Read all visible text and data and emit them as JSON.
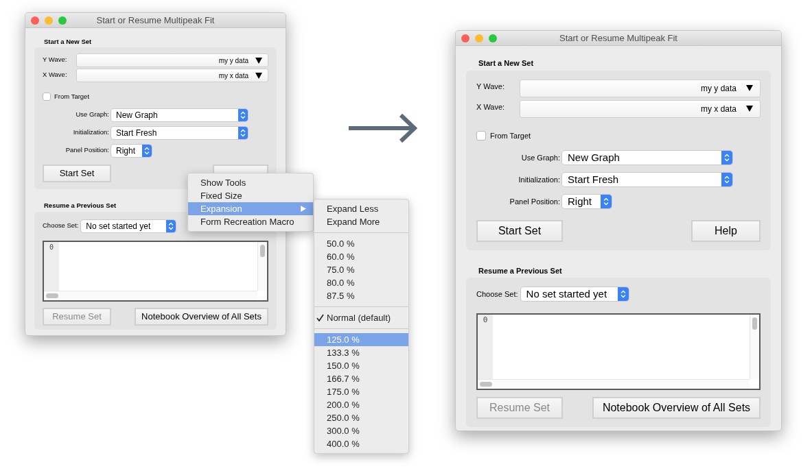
{
  "windows": [
    {
      "title": "Start or Resume Multipeak Fit",
      "new_set": {
        "heading": "Start a New Set",
        "waves": [
          {
            "label": "Y Wave:",
            "value": "my y data"
          },
          {
            "label": "X Wave:",
            "value": "my x data"
          }
        ],
        "from_target": {
          "label": "From Target",
          "checked": false
        },
        "popups": [
          {
            "label": "Use Graph:",
            "value": "New Graph",
            "kind": "wide"
          },
          {
            "label": "Initialization:",
            "value": "Start Fresh",
            "kind": "wide"
          },
          {
            "label": "Panel Position:",
            "value": "Right",
            "kind": "narrow"
          }
        ],
        "buttons": [
          {
            "label": "Start Set",
            "disabled": false
          }
        ]
      },
      "resume": {
        "heading": "Resume a Previous Set",
        "choose_set": {
          "label": "Choose Set:",
          "value": "No set started yet"
        },
        "listing": {
          "line_number": "0"
        },
        "buttons": [
          {
            "label": "Resume Set",
            "disabled": true
          },
          {
            "label": "Notebook Overview of All Sets",
            "disabled": false
          }
        ]
      }
    },
    {
      "title": "Start or Resume Multipeak Fit",
      "new_set": {
        "heading": "Start a New Set",
        "waves": [
          {
            "label": "Y Wave:",
            "value": "my y data"
          },
          {
            "label": "X Wave:",
            "value": "my x data"
          }
        ],
        "from_target": {
          "label": "From Target",
          "checked": false
        },
        "popups": [
          {
            "label": "Use Graph:",
            "value": "New Graph",
            "kind": "wide"
          },
          {
            "label": "Initialization:",
            "value": "Start Fresh",
            "kind": "wide"
          },
          {
            "label": "Panel Position:",
            "value": "Right",
            "kind": "narrow"
          }
        ],
        "buttons": [
          {
            "label": "Start Set",
            "disabled": false
          },
          {
            "label": "Help",
            "disabled": false
          }
        ]
      },
      "resume": {
        "heading": "Resume a Previous Set",
        "choose_set": {
          "label": "Choose Set:",
          "value": "No set started yet"
        },
        "listing": {
          "line_number": "0"
        },
        "buttons": [
          {
            "label": "Resume Set",
            "disabled": true
          },
          {
            "label": "Notebook Overview of All Sets",
            "disabled": false
          }
        ]
      }
    }
  ],
  "context_menu": {
    "items": [
      {
        "label": "Show Tools",
        "selected": false,
        "submenu": false
      },
      {
        "label": "Fixed Size",
        "selected": false,
        "submenu": false
      },
      {
        "label": "Expansion",
        "selected": true,
        "submenu": true
      },
      {
        "label": "Form Recreation Macro",
        "selected": false,
        "submenu": false
      }
    ],
    "submenu": {
      "groups": [
        [
          {
            "label": "Expand Less",
            "checked": false,
            "selected": false
          },
          {
            "label": "Expand More",
            "checked": false,
            "selected": false
          }
        ],
        [
          {
            "label": "50.0 %",
            "checked": false,
            "selected": false
          },
          {
            "label": "60.0 %",
            "checked": false,
            "selected": false
          },
          {
            "label": "75.0 %",
            "checked": false,
            "selected": false
          },
          {
            "label": "80.0 %",
            "checked": false,
            "selected": false
          },
          {
            "label": "87.5 %",
            "checked": false,
            "selected": false
          }
        ],
        [
          {
            "label": "Normal (default)",
            "checked": true,
            "selected": false
          }
        ],
        [
          {
            "label": "125.0 %",
            "checked": false,
            "selected": true
          },
          {
            "label": "133.3 %",
            "checked": false,
            "selected": false
          },
          {
            "label": "150.0 %",
            "checked": false,
            "selected": false
          },
          {
            "label": "166.7 %",
            "checked": false,
            "selected": false
          },
          {
            "label": "175.0 %",
            "checked": false,
            "selected": false
          },
          {
            "label": "200.0 %",
            "checked": false,
            "selected": false
          },
          {
            "label": "250.0 %",
            "checked": false,
            "selected": false
          },
          {
            "label": "300.0 %",
            "checked": false,
            "selected": false
          },
          {
            "label": "400.0 %",
            "checked": false,
            "selected": false
          }
        ]
      ]
    }
  }
}
